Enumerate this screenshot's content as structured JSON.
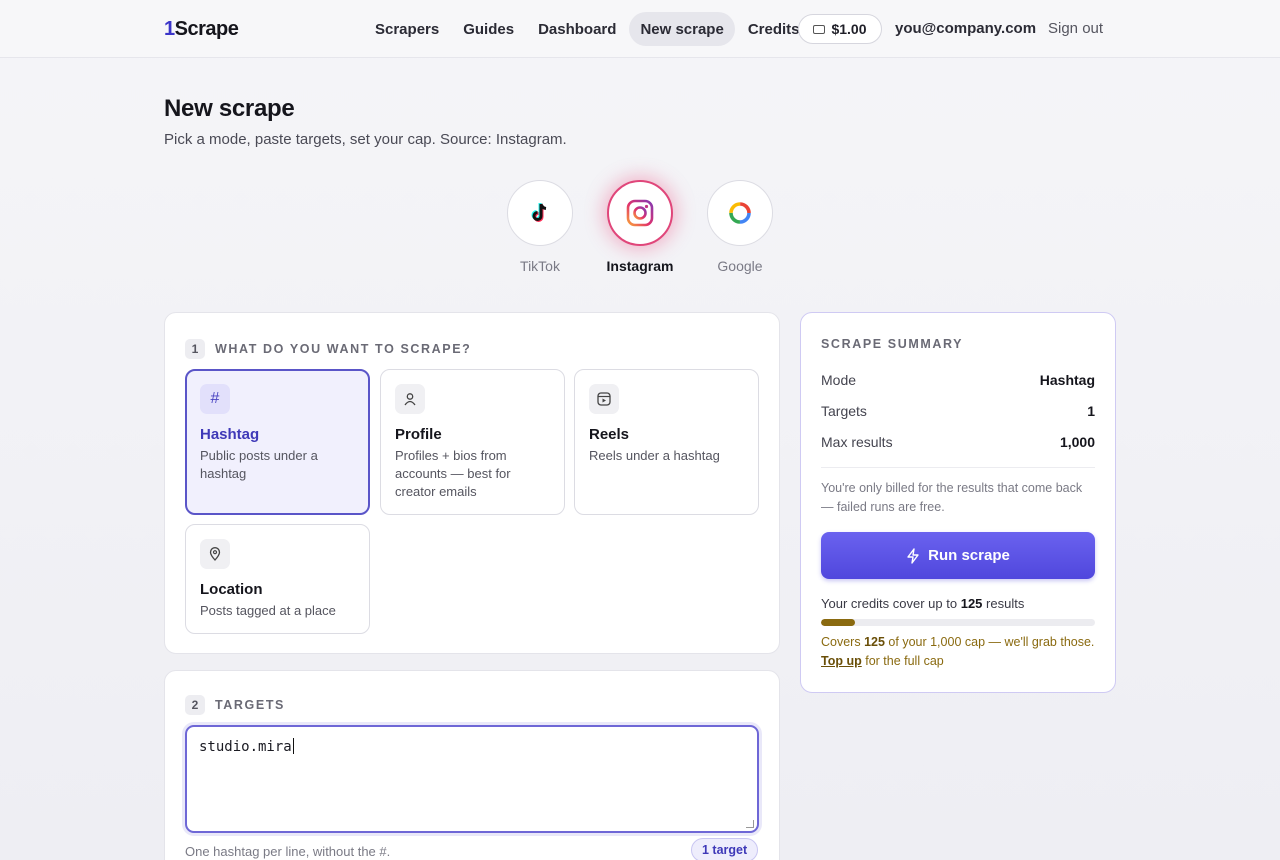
{
  "header": {
    "logo_num": "1",
    "logo_text": "Scrape",
    "nav": [
      {
        "label": "Scrapers"
      },
      {
        "label": "Guides"
      },
      {
        "label": "Dashboard"
      },
      {
        "label": "New scrape",
        "active": true
      },
      {
        "label": "Credits"
      }
    ],
    "balance": "$1.00",
    "email": "you@company.com",
    "sign_out": "Sign out"
  },
  "page": {
    "title": "New scrape",
    "subtitle": "Pick a mode, paste targets, set your cap. Source: Instagram."
  },
  "sources": [
    {
      "label": "TikTok",
      "icon": "tiktok-icon"
    },
    {
      "label": "Instagram",
      "icon": "instagram-icon",
      "active": true
    },
    {
      "label": "Google",
      "icon": "google-icon"
    }
  ],
  "step1": {
    "num": "1",
    "title": "WHAT DO YOU WANT TO SCRAPE?",
    "modes": [
      {
        "title": "Hashtag",
        "desc": "Public posts under a hashtag",
        "icon": "hash-icon",
        "active": true
      },
      {
        "title": "Profile",
        "desc": "Profiles + bios from accounts — best for creator emails",
        "icon": "user-icon"
      },
      {
        "title": "Reels",
        "desc": "Reels under a hashtag",
        "icon": "reels-icon"
      },
      {
        "title": "Location",
        "desc": "Posts tagged at a place",
        "icon": "location-pin-icon"
      }
    ]
  },
  "step2": {
    "num": "2",
    "title": "TARGETS",
    "value": "studio.mira",
    "hint": "One hashtag per line, without the #.",
    "badge": "1 target"
  },
  "summary": {
    "title": "SCRAPE SUMMARY",
    "rows": [
      {
        "k": "Mode",
        "v": "Hashtag"
      },
      {
        "k": "Targets",
        "v": "1"
      },
      {
        "k": "Max results",
        "v": "1,000"
      }
    ],
    "note": "You're only billed for the results that come back — failed runs are free.",
    "run_label": "Run scrape",
    "cover_prefix": "Your credits cover up to",
    "cover_value": "125",
    "cover_suffix": "results",
    "progress_fraction": 0.125,
    "warn_prefix": "Covers",
    "warn_value": "125",
    "warn_mid": "of your 1,000 cap — we'll grab those.",
    "warn_link": "Top up",
    "warn_suffix": "for the full cap"
  },
  "colors": {
    "accent": "#5047dd",
    "instagram_ring": "#e0467a",
    "warn": "#8a6a10"
  }
}
